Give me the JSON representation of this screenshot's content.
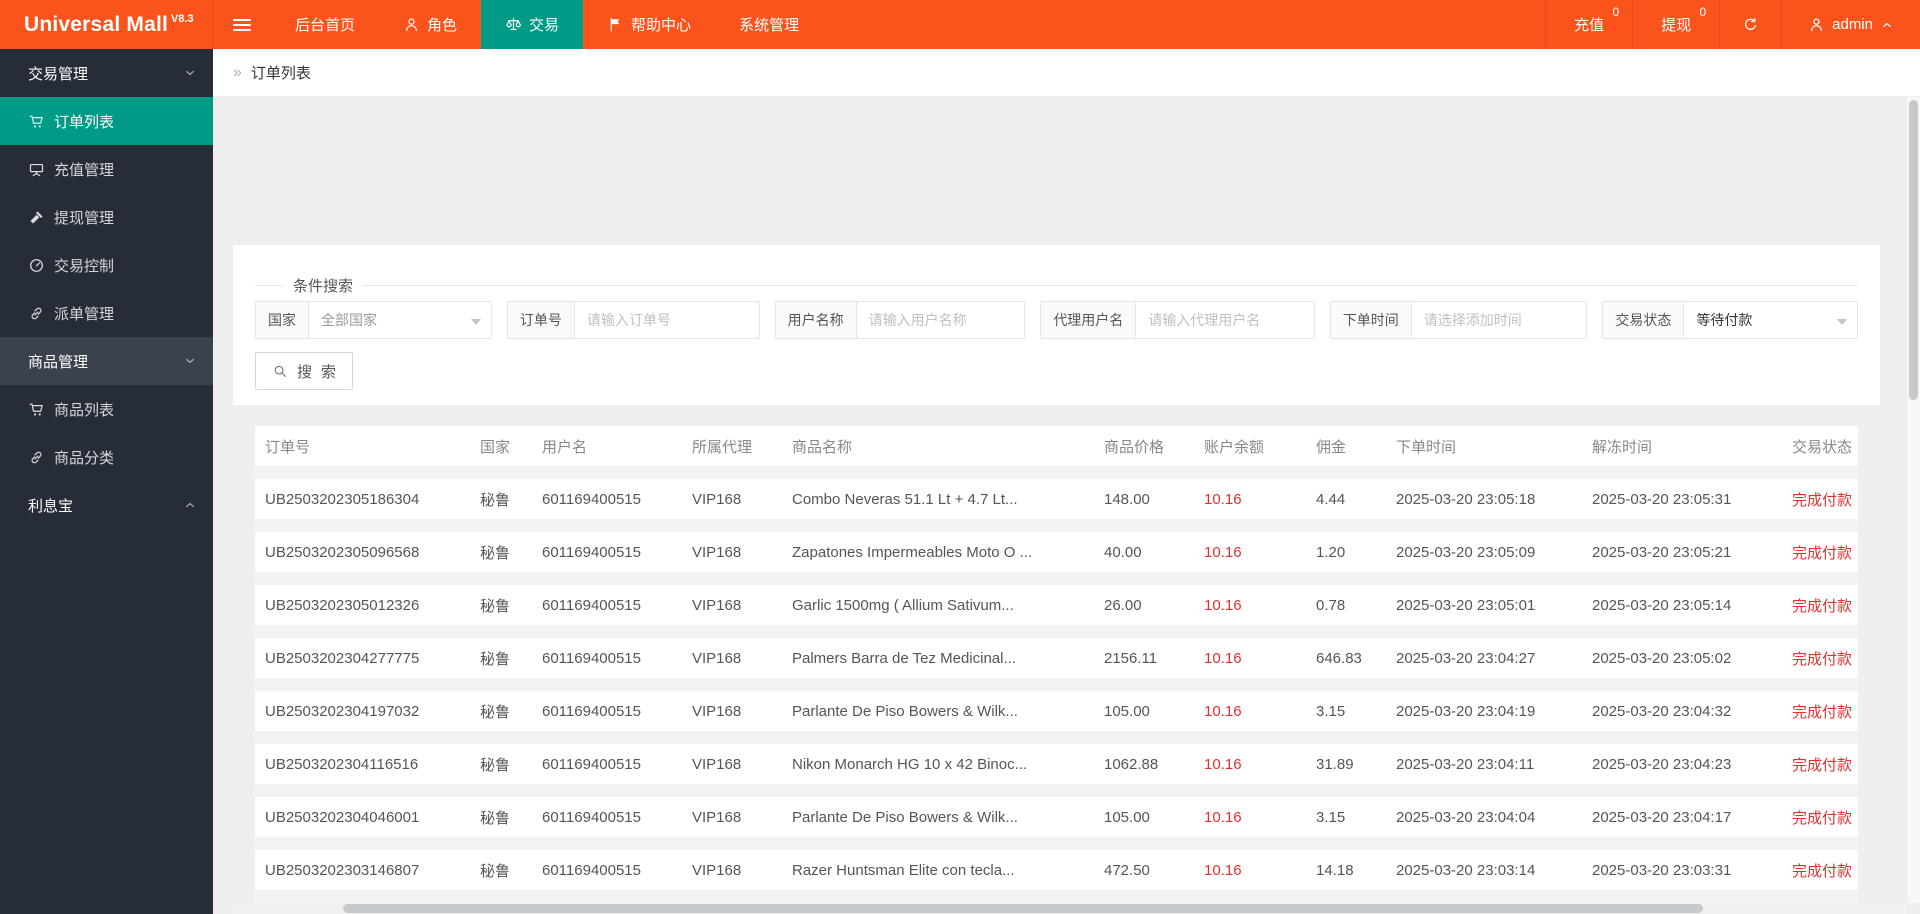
{
  "colors": {
    "brand_orange": "#fa541c",
    "active_teal": "#009b87",
    "danger_red": "#e0312e",
    "sidebar_dark": "#262d38"
  },
  "app": {
    "name": "Universal Mall",
    "version": "V8.3"
  },
  "topbar": {
    "nav": [
      {
        "key": "home",
        "label": "后台首页",
        "icon": null,
        "active": false
      },
      {
        "key": "roles",
        "label": "角色",
        "icon": "person",
        "active": false
      },
      {
        "key": "trade",
        "label": "交易",
        "icon": "scales",
        "active": true
      },
      {
        "key": "help-center",
        "label": "帮助中心",
        "icon": "flag",
        "active": false
      },
      {
        "key": "system",
        "label": "系统管理",
        "icon": null,
        "active": false
      }
    ],
    "recharge": {
      "label": "充值",
      "badge": "0"
    },
    "withdraw": {
      "label": "提现",
      "badge": "0"
    },
    "user": {
      "name": "admin"
    }
  },
  "sidebar": {
    "items": [
      {
        "key": "trade-management",
        "type": "group",
        "label": "交易管理",
        "chevron": "down",
        "highlight": false
      },
      {
        "key": "order-list",
        "type": "item",
        "label": "订单列表",
        "icon": "cart",
        "active": true
      },
      {
        "key": "recharge-management",
        "type": "item",
        "label": "充值管理",
        "icon": "board",
        "active": false
      },
      {
        "key": "withdraw-management",
        "type": "item",
        "label": "提现管理",
        "icon": "hammer",
        "active": false
      },
      {
        "key": "trade-control",
        "type": "item",
        "label": "交易控制",
        "icon": "gauge",
        "active": false
      },
      {
        "key": "dispatch-management",
        "type": "item",
        "label": "派单管理",
        "icon": "link",
        "active": false
      },
      {
        "key": "goods-management",
        "type": "group",
        "label": "商品管理",
        "chevron": "down",
        "highlight": true
      },
      {
        "key": "goods-list",
        "type": "item",
        "label": "商品列表",
        "icon": "cart",
        "active": false
      },
      {
        "key": "goods-category",
        "type": "item",
        "label": "商品分类",
        "icon": "link",
        "active": false
      },
      {
        "key": "interest-treasure",
        "type": "group",
        "label": "利息宝",
        "chevron": "up",
        "highlight": false
      }
    ]
  },
  "breadcrumb": {
    "separator": "»",
    "current": "订单列表"
  },
  "search": {
    "legend": "条件搜索",
    "fields": [
      {
        "key": "country",
        "label": "国家",
        "type": "select",
        "value": "全部国家",
        "muted": true
      },
      {
        "key": "order-no",
        "label": "订单号",
        "type": "input",
        "placeholder": "请输入订单号"
      },
      {
        "key": "username",
        "label": "用户名称",
        "type": "input",
        "placeholder": "请输入用户名称"
      },
      {
        "key": "agent-username",
        "label": "代理用户名",
        "type": "input",
        "placeholder": "请输入代理用户名"
      },
      {
        "key": "order-time",
        "label": "下单时间",
        "type": "input",
        "placeholder": "请选择添加时间"
      },
      {
        "key": "trade-status",
        "label": "交易状态",
        "type": "select",
        "value": "等待付款",
        "muted": false
      }
    ],
    "button_label": "搜索"
  },
  "table": {
    "headers": [
      {
        "key": "order_no",
        "label": "订单号"
      },
      {
        "key": "country",
        "label": "国家"
      },
      {
        "key": "username",
        "label": "用户名"
      },
      {
        "key": "agent",
        "label": "所属代理"
      },
      {
        "key": "product",
        "label": "商品名称"
      },
      {
        "key": "price",
        "label": "商品价格"
      },
      {
        "key": "balance",
        "label": "账户余额"
      },
      {
        "key": "commission",
        "label": "佣金"
      },
      {
        "key": "order_time",
        "label": "下单时间"
      },
      {
        "key": "unfreeze_time",
        "label": "解冻时间"
      },
      {
        "key": "status",
        "label": "交易状态"
      }
    ],
    "rows": [
      {
        "order_no": "UB2503202305186304",
        "country": "秘鲁",
        "username": "601169400515",
        "agent": "VIP168",
        "product": "Combo Neveras 51.1 Lt + 4.7 Lt...",
        "price": "148.00",
        "balance": "10.16",
        "commission": "4.44",
        "order_time": "2025-03-20 23:05:18",
        "unfreeze_time": "2025-03-20 23:05:31",
        "status": "完成付款"
      },
      {
        "order_no": "UB2503202305096568",
        "country": "秘鲁",
        "username": "601169400515",
        "agent": "VIP168",
        "product": "Zapatones Impermeables Moto O ...",
        "price": "40.00",
        "balance": "10.16",
        "commission": "1.20",
        "order_time": "2025-03-20 23:05:09",
        "unfreeze_time": "2025-03-20 23:05:21",
        "status": "完成付款"
      },
      {
        "order_no": "UB2503202305012326",
        "country": "秘鲁",
        "username": "601169400515",
        "agent": "VIP168",
        "product": "Garlic 1500mg ( Allium Sativum...",
        "price": "26.00",
        "balance": "10.16",
        "commission": "0.78",
        "order_time": "2025-03-20 23:05:01",
        "unfreeze_time": "2025-03-20 23:05:14",
        "status": "完成付款"
      },
      {
        "order_no": "UB2503202304277775",
        "country": "秘鲁",
        "username": "601169400515",
        "agent": "VIP168",
        "product": "Palmers Barra de Tez Medicinal...",
        "price": "2156.11",
        "balance": "10.16",
        "commission": "646.83",
        "order_time": "2025-03-20 23:04:27",
        "unfreeze_time": "2025-03-20 23:05:02",
        "status": "完成付款"
      },
      {
        "order_no": "UB2503202304197032",
        "country": "秘鲁",
        "username": "601169400515",
        "agent": "VIP168",
        "product": "Parlante De Piso Bowers & Wilk...",
        "price": "105.00",
        "balance": "10.16",
        "commission": "3.15",
        "order_time": "2025-03-20 23:04:19",
        "unfreeze_time": "2025-03-20 23:04:32",
        "status": "完成付款"
      },
      {
        "order_no": "UB2503202304116516",
        "country": "秘鲁",
        "username": "601169400515",
        "agent": "VIP168",
        "product": "Nikon Monarch HG 10 x 42 Binoc...",
        "price": "1062.88",
        "balance": "10.16",
        "commission": "31.89",
        "order_time": "2025-03-20 23:04:11",
        "unfreeze_time": "2025-03-20 23:04:23",
        "status": "完成付款"
      },
      {
        "order_no": "UB2503202304046001",
        "country": "秘鲁",
        "username": "601169400515",
        "agent": "VIP168",
        "product": "Parlante De Piso Bowers & Wilk...",
        "price": "105.00",
        "balance": "10.16",
        "commission": "3.15",
        "order_time": "2025-03-20 23:04:04",
        "unfreeze_time": "2025-03-20 23:04:17",
        "status": "完成付款"
      },
      {
        "order_no": "UB2503202303146807",
        "country": "秘鲁",
        "username": "601169400515",
        "agent": "VIP168",
        "product": "Razer Huntsman Elite con tecla...",
        "price": "472.50",
        "balance": "10.16",
        "commission": "14.18",
        "order_time": "2025-03-20 23:03:14",
        "unfreeze_time": "2025-03-20 23:03:31",
        "status": "完成付款"
      }
    ]
  }
}
